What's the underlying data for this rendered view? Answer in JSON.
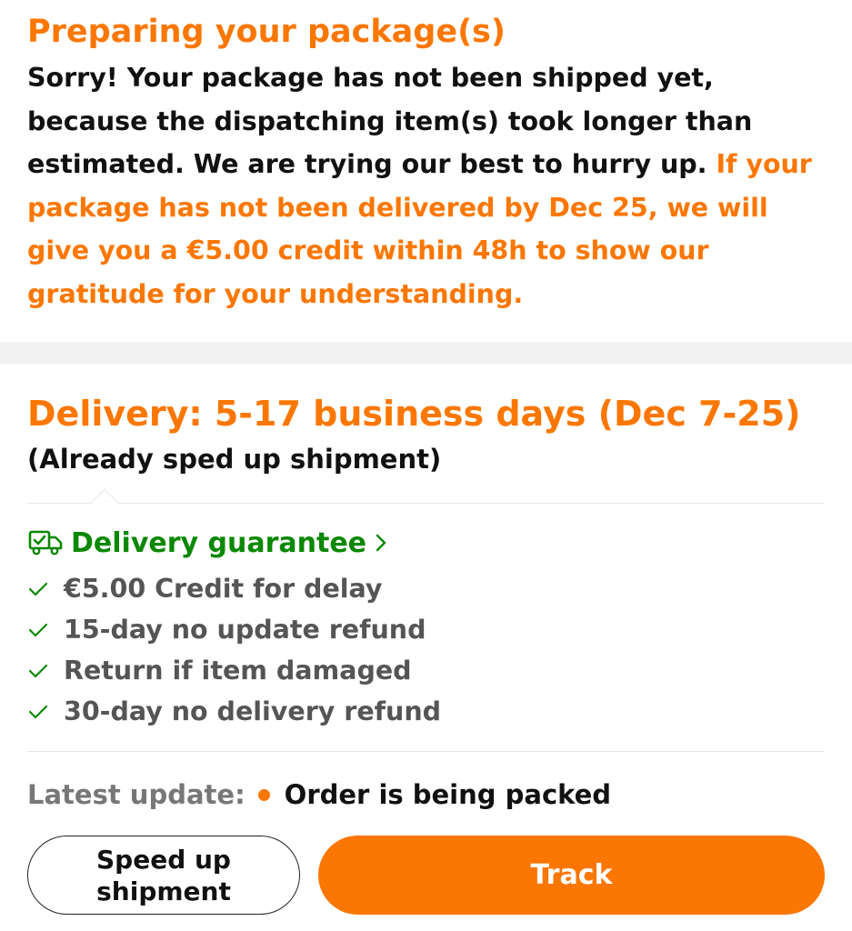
{
  "notice": {
    "title": "Preparing your package(s)",
    "body_text": "Sorry! Your package has not been shipped yet, because the dispatching item(s) took longer than estimated. We are trying our best to hurry up.",
    "highlight_text": "If your package has not been delivered by Dec 25, we will give you a €5.00 credit within 48h to show our gratitude for your understanding."
  },
  "delivery": {
    "title": "Delivery: 5-17 business days (Dec 7-25)",
    "subtitle": "(Already sped up shipment)"
  },
  "guarantee": {
    "label": "Delivery guarantee",
    "icon": "delivery-truck-check-icon",
    "items": [
      {
        "label": "€5.00 Credit for delay"
      },
      {
        "label": "15-day no update refund"
      },
      {
        "label": "Return if item damaged"
      },
      {
        "label": "30-day no delivery refund"
      }
    ]
  },
  "latest_update": {
    "label": "Latest update:",
    "status": "Order is being packed"
  },
  "buttons": {
    "speed_up": "Speed up shipment",
    "track": "Track"
  },
  "colors": {
    "accent": "#fb7701",
    "guarantee_green": "#0a8800",
    "text": "#111111",
    "muted": "#555555"
  }
}
